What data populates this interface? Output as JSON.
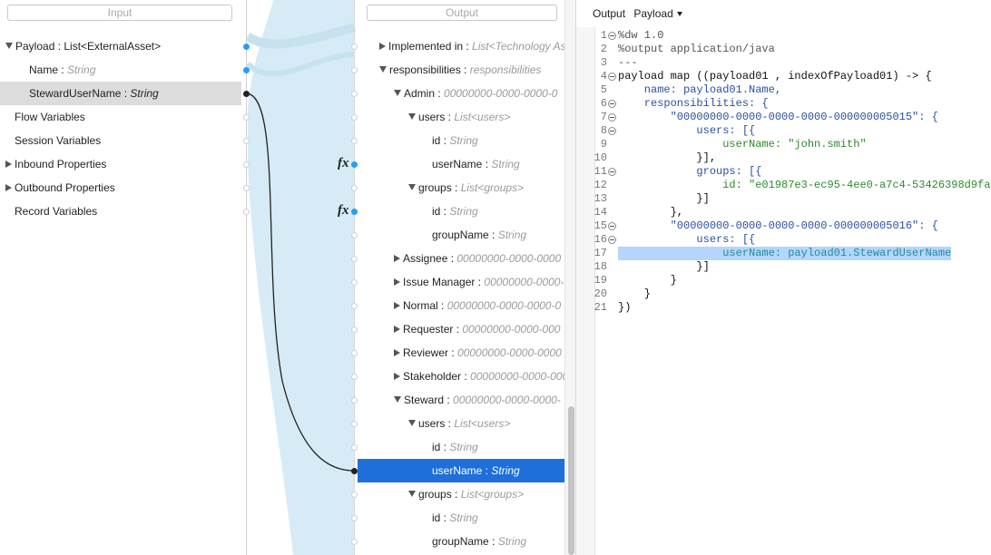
{
  "input": {
    "placeholder": "Input",
    "items": [
      {
        "label": "Payload : List<ExternalAsset>",
        "type": "",
        "arrow": "down"
      },
      {
        "label": "Name : ",
        "type": "String"
      },
      {
        "label": "StewardUserName : ",
        "type": "String"
      },
      {
        "label": "Flow Variables",
        "type": ""
      },
      {
        "label": "Session Variables",
        "type": ""
      },
      {
        "label": "Inbound Properties",
        "type": "",
        "arrow": "right"
      },
      {
        "label": "Outbound Properties",
        "type": "",
        "arrow": "right"
      },
      {
        "label": "Record Variables",
        "type": ""
      }
    ]
  },
  "output": {
    "placeholder": "Output",
    "items": [
      {
        "label": "Implemented in : ",
        "type": "List<Technology As"
      },
      {
        "label": "responsibilities : ",
        "type": "responsibilities"
      },
      {
        "label": "Admin : ",
        "type": "00000000-0000-0000-0"
      },
      {
        "label": "users : ",
        "type": "List<users>"
      },
      {
        "label": "id : ",
        "type": "String"
      },
      {
        "label": "userName : ",
        "type": "String"
      },
      {
        "label": "groups : ",
        "type": "List<groups>"
      },
      {
        "label": "id : ",
        "type": "String"
      },
      {
        "label": "groupName : ",
        "type": "String"
      },
      {
        "label": "Assignee : ",
        "type": "00000000-0000-0000"
      },
      {
        "label": "Issue Manager : ",
        "type": "00000000-0000-"
      },
      {
        "label": "Normal : ",
        "type": "00000000-0000-0000-0"
      },
      {
        "label": "Requester : ",
        "type": "00000000-0000-000"
      },
      {
        "label": "Reviewer : ",
        "type": "00000000-0000-0000"
      },
      {
        "label": "Stakeholder : ",
        "type": "00000000-0000-000"
      },
      {
        "label": "Steward : ",
        "type": "00000000-0000-0000-"
      },
      {
        "label": "users : ",
        "type": "List<users>"
      },
      {
        "label": "id : ",
        "type": "String"
      },
      {
        "label": "userName : ",
        "type": "String"
      },
      {
        "label": "groups : ",
        "type": "List<groups>"
      },
      {
        "label": "id : ",
        "type": "String"
      },
      {
        "label": "groupName : ",
        "type": "String"
      }
    ],
    "fx": "fx"
  },
  "editor": {
    "title": "Output",
    "target": "Payload",
    "lines": [
      {
        "n": "1",
        "t": "%dw 1.0"
      },
      {
        "n": "2",
        "t": "%output application/java"
      },
      {
        "n": "3",
        "t": "---"
      },
      {
        "n": "4",
        "t": "payload map ((payload01 , indexOfPayload01) -> {"
      },
      {
        "n": "5",
        "t": "    name: payload01.Name,"
      },
      {
        "n": "6",
        "t": "    responsibilities: {"
      },
      {
        "n": "7",
        "t": "        \"00000000-0000-0000-0000-000000005015\": {"
      },
      {
        "n": "8",
        "t": "            users: [{"
      },
      {
        "n": "9",
        "t": "                userName: \"john.smith\""
      },
      {
        "n": "10",
        "t": "            }],"
      },
      {
        "n": "11",
        "t": "            groups: [{"
      },
      {
        "n": "12",
        "t": "                id: \"e01987e3-ec95-4ee0-a7c4-53426398d9fa\""
      },
      {
        "n": "13",
        "t": "            }]"
      },
      {
        "n": "14",
        "t": "        },"
      },
      {
        "n": "15",
        "t": "        \"00000000-0000-0000-0000-000000005016\": {"
      },
      {
        "n": "16",
        "t": "            users: [{"
      },
      {
        "n": "17",
        "t": "                userName: payload01.StewardUserName"
      },
      {
        "n": "18",
        "t": "            }]"
      },
      {
        "n": "19",
        "t": "        }"
      },
      {
        "n": "20",
        "t": "    }"
      },
      {
        "n": "21",
        "t": "})"
      }
    ]
  },
  "colors": {
    "accent": "#1e6fd9",
    "mapping-band": "#d6ebf5",
    "connector-dot": "#2a9df4"
  }
}
